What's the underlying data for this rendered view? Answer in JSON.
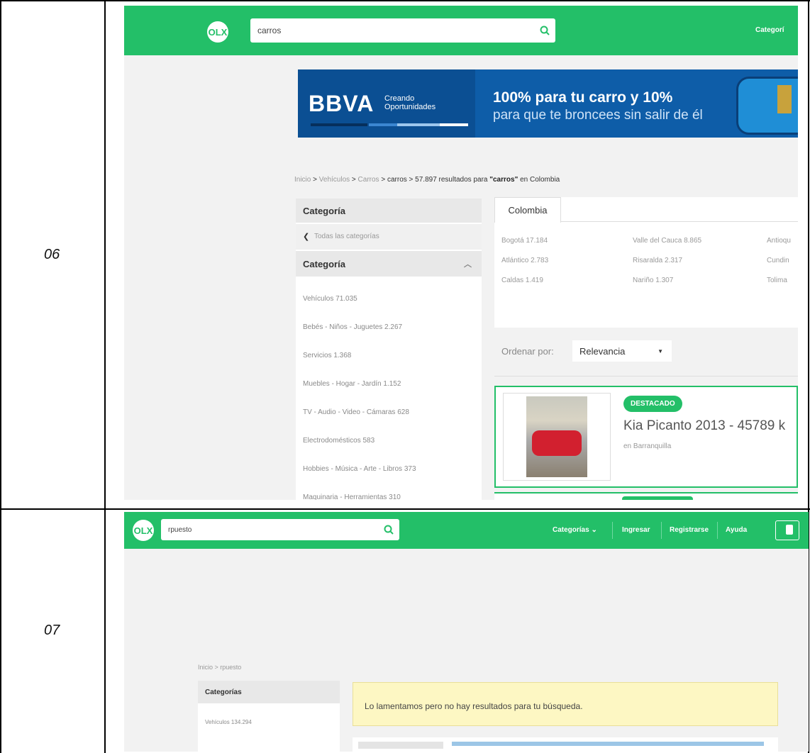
{
  "rows": [
    {
      "label": "06",
      "search_value": "carros",
      "nav_item": "Categorí",
      "banner": {
        "brand": "BBVA",
        "tagline_1": "Creando",
        "tagline_2": "Oportunidades",
        "headline": "100% para tu carro y 10%",
        "subline": "para que te broncees sin salir de él"
      },
      "breadcrumb": {
        "parts": [
          "Inicio",
          ">",
          "Vehículos",
          ">",
          "Carros",
          ">",
          "carros",
          ">"
        ],
        "result_text": "57.897 resultados para",
        "query": "\"carros\"",
        "tail": "en Colombia"
      },
      "sidebar": {
        "header1": "Categoría",
        "back_link": "Todas las categorías",
        "header2": "Categoría",
        "items": [
          "Vehículos 71.035",
          "Bebés - Niños - Juguetes 2.267",
          "Servicios 1.368",
          "Muebles - Hogar - Jardín 1.152",
          "TV - Audio - Video - Cámaras 628",
          "Electrodomésticos 583",
          "Hobbies - Música - Arte - Libros 373",
          "Maquinaria - Herramientas 310"
        ]
      },
      "location": {
        "tab": "Colombia",
        "col1": [
          "Bogotá 17.184",
          "Atlántico 2.783",
          "Caldas 1.419"
        ],
        "col2": [
          "Valle del Cauca 8.865",
          "Risaralda 2.317",
          "Nariño 1.307"
        ],
        "col3": [
          "Antioqu",
          "Cundin",
          "Tolima"
        ]
      },
      "sort": {
        "label": "Ordenar por:",
        "value": "Relevancia"
      },
      "listing": {
        "badge": "DESTACADO",
        "title": "Kia Picanto 2013 - 45789 k",
        "location": "en Barranquilla"
      }
    },
    {
      "label": "07",
      "search_value": "rpuesto",
      "nav": [
        "Categorías",
        "Ingresar",
        "Registrarse",
        "Ayuda"
      ],
      "breadcrumb": "Inicio > rpuesto",
      "sidebar_header": "Categorías",
      "sidebar_item": "Vehículos 134.294",
      "no_results": "Lo lamentamos pero no hay resultados para tu búsqueda."
    }
  ],
  "colors": {
    "olx_green": "#23bf68",
    "bbva_blue": "#0e5da8",
    "notice_yellow": "#fdf7c3"
  }
}
